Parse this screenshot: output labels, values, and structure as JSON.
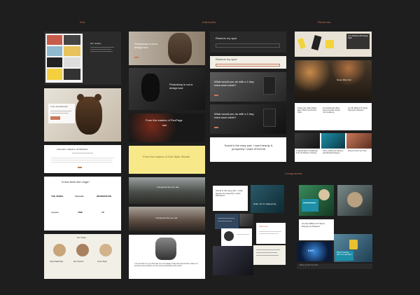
{
  "sections": {
    "info": "Info",
    "interludes": "Interludes",
    "reserves": "Reserves",
    "components": "Components"
  },
  "info": {
    "card1_title": "Kim Justice",
    "card2_title": "Color Me Beautiful",
    "card3_title": "Automatic, Adaptive, All Websites",
    "card4_quote": "\"A that feels like magic\"",
    "logos": [
      "THE VERGE",
      "Mashable",
      "INFORMATION",
      "eng/edu",
      "TNW",
      "TC",
      "PCMag",
      "Fast Co."
    ],
    "card5_title": "Our Team",
    "team": [
      "Hasan Bakhshaa",
      "Dan Tocchini",
      "Jacob Taylor"
    ]
  },
  "interludes": {
    "i1": "Photoshop is not a design tool",
    "i2": "Photoshop is not a design tool",
    "i3": "From the makers of FlexPage",
    "i4": "From the makers of Grid Style Sheets",
    "i5": "It depends who you ask",
    "i6": "It depends who you ask",
    "i7": "I do not think it is you that has our own design Tools that has led the modern on as best some creation on the most symbiosing to the world"
  },
  "reserves_col": {
    "r1": "Reserve my spot",
    "r2": "Reserve my spot",
    "r3": "What would you do with a 1 day extra each week?",
    "r4": "What would you do with a 1 day extra each week?",
    "r5": "Social is the easy part. I want beauty & prosperity! I want #TheGrid"
  },
  "reserves": {
    "p1": "Your Website Will Design Itself",
    "p2": "Never Miss Out",
    "f1": "Social Life. Sales Made Easy. Build Your Dream Shop",
    "f2": "Got Facebook's Best Face Forward. Reach Your Audience",
    "f3": "Are My Millions Of Taxes Paying For Beauty?",
    "f4": "A Special Way to Collaborate From the Masters of Design",
    "f5": "Come to Bring You Work by Like-Minded Designers",
    "f6": "Where to Find Your Tribe"
  },
  "components": {
    "c1": "Social is the easy part. I want beauty & prosperity! I want #TheGrid",
    "c2": "Hello, Hi! I'm Happening",
    "c3": "Welcome!",
    "c4": "Are My Millions Of Taxes Paying For Beauty?",
    "c5": "What If Tuesday Was Your Last Day?",
    "c6": "EXIT",
    "c7": "Where to Find Your Tribe"
  },
  "colors": {
    "background": "#1e1e1e",
    "accent": "#c9785a",
    "label": "#d9765f",
    "yellow": "#f7e98a",
    "teal": "#1f8fa8"
  }
}
